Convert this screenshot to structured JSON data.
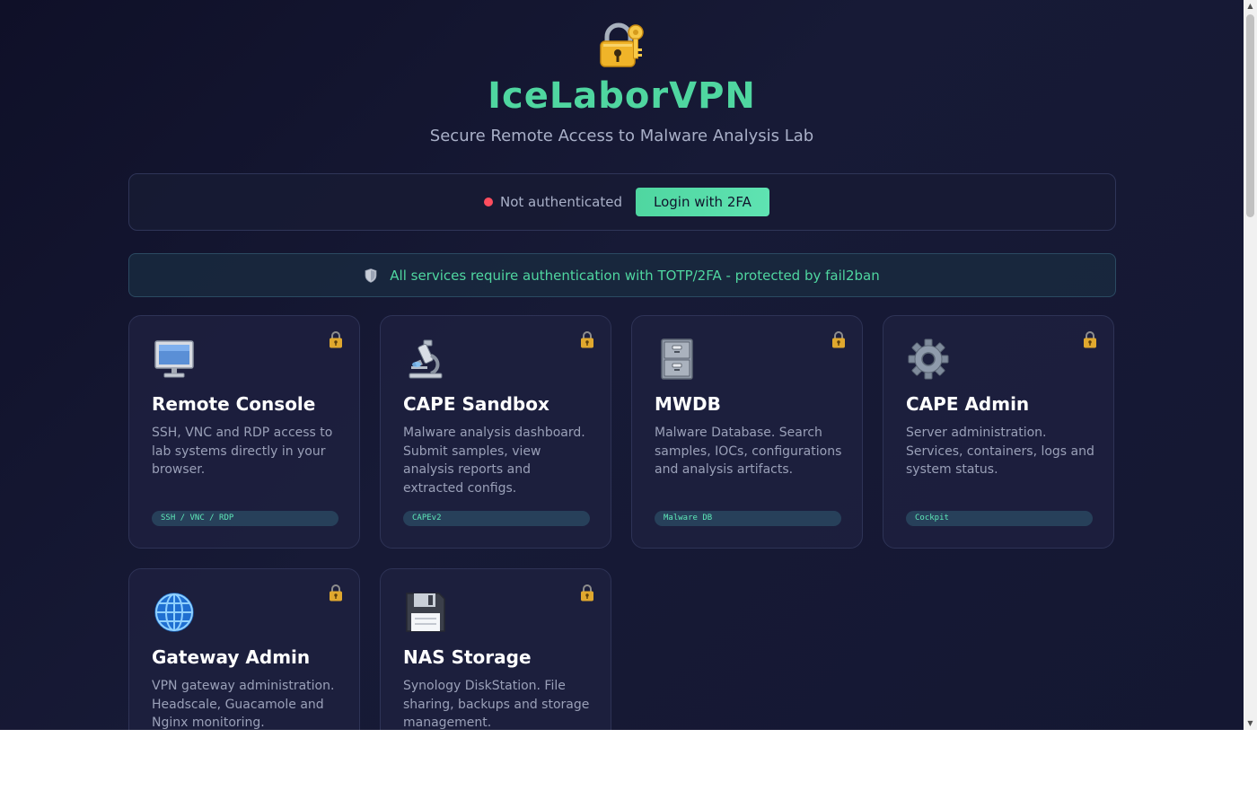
{
  "header": {
    "logo_icon": "lock-with-key-icon",
    "title": "IceLaborVPN",
    "subtitle": "Secure Remote Access to Malware Analysis Lab"
  },
  "auth": {
    "status_text": "Not authenticated",
    "status_color": "#ff4d5e",
    "login_label": "Login with 2FA"
  },
  "notice": {
    "icon": "shield-icon",
    "text": "All services require authentication with TOTP/2FA - protected by fail2ban"
  },
  "colors": {
    "accent": "#4fd6a0",
    "background": "#141732",
    "card": "#1d203e"
  },
  "services": [
    {
      "icon": "computer-monitor-icon",
      "title": "Remote Console",
      "description": "SSH, VNC and RDP access to lab systems directly in your browser.",
      "tag": "SSH / VNC / RDP"
    },
    {
      "icon": "microscope-icon",
      "title": "CAPE Sandbox",
      "description": "Malware analysis dashboard. Submit samples, view analysis reports and extracted configs.",
      "tag": "CAPEv2"
    },
    {
      "icon": "file-cabinet-icon",
      "title": "MWDB",
      "description": "Malware Database. Search samples, IOCs, configurations and analysis artifacts.",
      "tag": "Malware DB"
    },
    {
      "icon": "gear-icon",
      "title": "CAPE Admin",
      "description": "Server administration. Services, containers, logs and system status.",
      "tag": "Cockpit"
    },
    {
      "icon": "globe-icon",
      "title": "Gateway Admin",
      "description": "VPN gateway administration. Headscale, Guacamole and Nginx monitoring."
    },
    {
      "icon": "floppy-disk-icon",
      "title": "NAS Storage",
      "description": "Synology DiskStation. File sharing, backups and storage management."
    }
  ]
}
